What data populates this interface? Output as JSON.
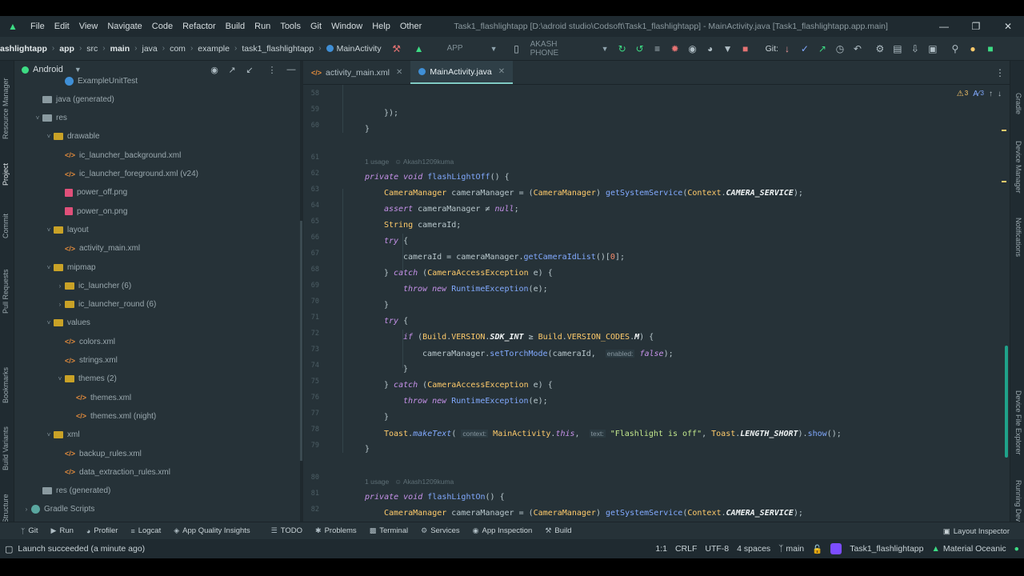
{
  "menu": {
    "items": [
      "File",
      "Edit",
      "View",
      "Navigate",
      "Code",
      "Refactor",
      "Build",
      "Run",
      "Tools",
      "Git",
      "Window",
      "Help",
      "Other"
    ],
    "window_title": "Task1_flashlightapp [D:\\adroid studio\\Codsoft\\Task1_flashlightapp] - MainActivity.java [Task1_flashlightapp.app.main]"
  },
  "breadcrumb": {
    "items": [
      "ashlightapp",
      "app",
      "src",
      "main",
      "java",
      "com",
      "example",
      "task1_flashlightapp",
      "MainActivity"
    ]
  },
  "toolbar": {
    "run_config": "APP",
    "device": "AKASH PHONE",
    "git_label": "Git:"
  },
  "project": {
    "view_name": "Android",
    "tree": [
      {
        "label": "ExampleUnitTest",
        "type": "class",
        "depth": 3,
        "arrow": ""
      },
      {
        "label": "java (generated)",
        "type": "folder-grey",
        "depth": 1,
        "arrow": ""
      },
      {
        "label": "res",
        "type": "folder-grey",
        "depth": 1,
        "arrow": "v"
      },
      {
        "label": "drawable",
        "type": "folder",
        "depth": 2,
        "arrow": "v"
      },
      {
        "label": "ic_launcher_background.xml",
        "type": "xml",
        "depth": 3,
        "arrow": ""
      },
      {
        "label": "ic_launcher_foreground.xml (v24)",
        "type": "xml",
        "depth": 3,
        "arrow": ""
      },
      {
        "label": "power_off.png",
        "type": "png",
        "depth": 3,
        "arrow": ""
      },
      {
        "label": "power_on.png",
        "type": "png",
        "depth": 3,
        "arrow": ""
      },
      {
        "label": "layout",
        "type": "folder",
        "depth": 2,
        "arrow": "v"
      },
      {
        "label": "activity_main.xml",
        "type": "xml",
        "depth": 3,
        "arrow": ""
      },
      {
        "label": "mipmap",
        "type": "folder",
        "depth": 2,
        "arrow": "v"
      },
      {
        "label": "ic_launcher (6)",
        "type": "folder",
        "depth": 3,
        "arrow": ">"
      },
      {
        "label": "ic_launcher_round (6)",
        "type": "folder",
        "depth": 3,
        "arrow": ">"
      },
      {
        "label": "values",
        "type": "folder",
        "depth": 2,
        "arrow": "v"
      },
      {
        "label": "colors.xml",
        "type": "xml",
        "depth": 3,
        "arrow": ""
      },
      {
        "label": "strings.xml",
        "type": "xml",
        "depth": 3,
        "arrow": ""
      },
      {
        "label": "themes (2)",
        "type": "folder",
        "depth": 3,
        "arrow": "v"
      },
      {
        "label": "themes.xml",
        "type": "xml",
        "depth": 4,
        "arrow": ""
      },
      {
        "label": "themes.xml (night)",
        "type": "xml",
        "depth": 4,
        "arrow": ""
      },
      {
        "label": "xml",
        "type": "folder",
        "depth": 2,
        "arrow": "v"
      },
      {
        "label": "backup_rules.xml",
        "type": "xml",
        "depth": 3,
        "arrow": ""
      },
      {
        "label": "data_extraction_rules.xml",
        "type": "xml",
        "depth": 3,
        "arrow": ""
      },
      {
        "label": "res (generated)",
        "type": "folder-grey",
        "depth": 1,
        "arrow": ""
      },
      {
        "label": "Gradle Scripts",
        "type": "gradle",
        "depth": 0,
        "arrow": ">"
      }
    ]
  },
  "left_strip": [
    "Resource Manager",
    "Project",
    "Commit",
    "Pull Requests",
    "Bookmarks",
    "Build Variants",
    "Structure"
  ],
  "right_strip": [
    "Gradle",
    "Device Manager",
    "Notifications",
    "Device File Explorer",
    "Running Devices"
  ],
  "editor": {
    "tabs": [
      {
        "label": "activity_main.xml",
        "active": false
      },
      {
        "label": "MainActivity.java",
        "active": true
      }
    ],
    "inspections": {
      "warnings": "3",
      "typos": "3"
    },
    "usage_hints": [
      {
        "usage": "1 usage",
        "author": "Akash1209kuma"
      },
      {
        "usage": "1 usage",
        "author": "Akash1209kuma"
      }
    ]
  },
  "bottom_tools": [
    "Git",
    "Run",
    "Profiler",
    "Logcat",
    "App Quality Insights",
    "TODO",
    "Problems",
    "Terminal",
    "Services",
    "App Inspection",
    "Build"
  ],
  "bottom_right_tool": "Layout Inspector",
  "status": {
    "message": "Launch succeeded (a minute ago)",
    "position": "1:1",
    "line_sep": "CRLF",
    "encoding": "UTF-8",
    "indent": "4 spaces",
    "branch": "main",
    "project": "Task1_flashlightapp",
    "theme": "Material Oceanic"
  },
  "colors": {
    "background": "#263238",
    "keyword": "#c792ea",
    "type": "#ffcb6b",
    "function": "#82aaff",
    "string": "#c3e88d",
    "accent": "#80cbc4"
  }
}
